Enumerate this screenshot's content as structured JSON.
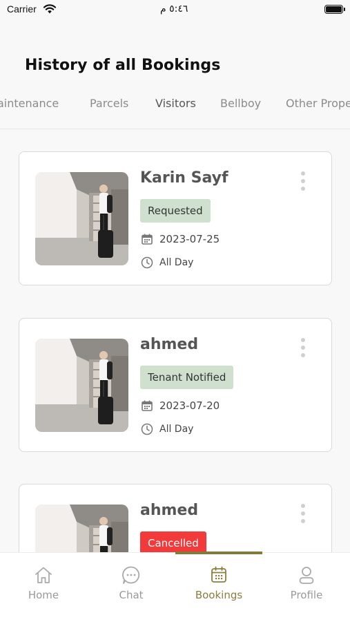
{
  "status_bar": {
    "carrier": "Carrier",
    "time": "٥:٤٦ م"
  },
  "page": {
    "title": "History of all Bookings"
  },
  "tabs": [
    "aintenance",
    "Parcels",
    "Visitors",
    "Bellboy",
    "Other Prope"
  ],
  "active_tab": "Visitors",
  "bookings": [
    {
      "name": "Karin Sayf",
      "status": "Requested",
      "status_color": "#cfe0cf",
      "date": "2023-07-25",
      "time": "All Day"
    },
    {
      "name": "ahmed",
      "status": "Tenant Notified",
      "status_color": "#cfe0cf",
      "date": "2023-07-20",
      "time": "All Day"
    },
    {
      "name": "ahmed",
      "status": "Cancelled",
      "status_color": "#f23a3a"
    }
  ],
  "nav": {
    "items": [
      "Home",
      "Chat",
      "Bookings",
      "Profile"
    ],
    "active": "Bookings",
    "accent": "#8a7d3d"
  }
}
